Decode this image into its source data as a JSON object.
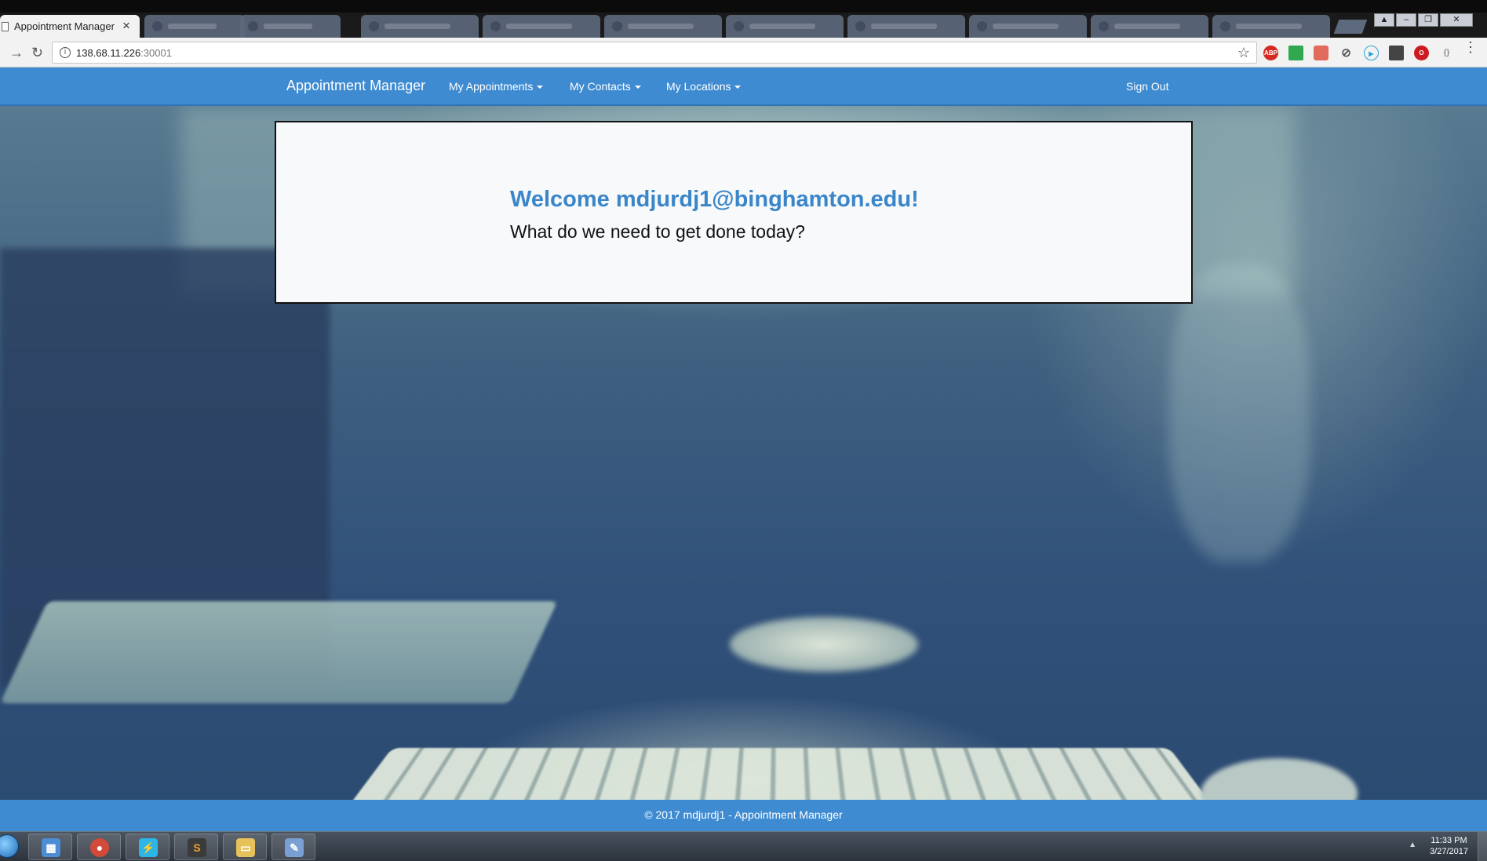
{
  "browser": {
    "active_tab_title": "Appointment Manager",
    "tab_close_glyph": "×",
    "url_host": "138.68.11.226",
    "url_port": ":30001",
    "info_glyph": "i",
    "star_glyph": "☆",
    "back_glyph": "→",
    "reload_glyph": "↻",
    "menu_glyph": "⋮",
    "extensions": [
      {
        "name": "adblock-icon",
        "label": "ABP",
        "color": "#d42a20"
      },
      {
        "name": "sheets-extension-icon",
        "label": "",
        "color": "#2fa84f"
      },
      {
        "name": "pdf-extension-icon",
        "label": "",
        "color": "#e06a5b"
      },
      {
        "name": "block-extension-icon",
        "label": "⊘",
        "color": "#555555"
      },
      {
        "name": "media-extension-icon",
        "label": "▶",
        "color": "#2aa3d8"
      },
      {
        "name": "save-extension-icon",
        "label": "",
        "color": "#444444"
      },
      {
        "name": "opera-extension-icon",
        "label": "O",
        "color": "#cc1b20"
      },
      {
        "name": "code-extension-icon",
        "label": "{}",
        "color": "#888888"
      }
    ],
    "window_controls": [
      "▲",
      "–",
      "❐",
      "✕"
    ]
  },
  "app": {
    "brand": "Appointment Manager",
    "nav": {
      "appointments": "My Appointments",
      "contacts": "My Contacts",
      "locations": "My Locations",
      "sign_out": "Sign Out"
    },
    "welcome": {
      "title": "Welcome mdjurdj1@binghamton.edu!",
      "subtitle": "What do we need to get done today?"
    },
    "footer": "© 2017 mdjurdj1 - Appointment Manager"
  },
  "taskbar": {
    "time": "11:33 PM",
    "date": "3/27/2017",
    "tray_arrow": "▲",
    "apps": [
      {
        "name": "task-manager-icon",
        "glyph": "▦",
        "color": "#4c8ed6"
      },
      {
        "name": "chrome-icon",
        "glyph": "●",
        "color": "#d34a3a"
      },
      {
        "name": "lightning-app-icon",
        "glyph": "⚡",
        "color": "#2db4e8"
      },
      {
        "name": "sublime-text-icon",
        "glyph": "S",
        "color": "#3b3b3b"
      },
      {
        "name": "file-explorer-icon",
        "glyph": "▭",
        "color": "#e7c15a"
      },
      {
        "name": "paint-icon",
        "glyph": "✎",
        "color": "#7a9fd4"
      }
    ]
  }
}
